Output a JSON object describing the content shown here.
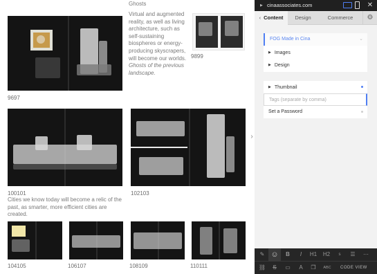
{
  "gallery": {
    "captions": {
      "c1": "9697",
      "c2": "9899",
      "c3": "100101",
      "c4": "102103",
      "c5": "104105",
      "c6": "106107",
      "c7": "108109",
      "c8": "110111"
    },
    "ghosts_title": "Ghosts",
    "ghosts_text": "Virtual and augmented reality, as well as living architecture, such as self-sustaining biospheres or energy-producing skyscrapers, will become our worlds.",
    "ghosts_italic": "Ghosts of the previous landscape.",
    "cities_text": "Cities we know today will become a relic of the past, as smarter, more efficient cities are created."
  },
  "panel": {
    "url": "cinaassociates.com",
    "tabs": {
      "content": "Content",
      "design": "Design",
      "commerce": "Commerce"
    },
    "title_field": "FOG Made in Cina",
    "images": "Images",
    "design": "Design",
    "thumbnail": "Thumbnail",
    "tags_placeholder": "Tags (separate by comma)",
    "password": "Set a Password"
  },
  "toolbar": {
    "bold": "B",
    "italic": "I",
    "h1": "H1",
    "h2": "H2",
    "abc": "ABC",
    "code_view": "CODE VIEW"
  },
  "colors": {
    "accent": "#4f7ef3",
    "panel_bg": "#f2f2f2",
    "toolbar_bg": "#262626"
  }
}
